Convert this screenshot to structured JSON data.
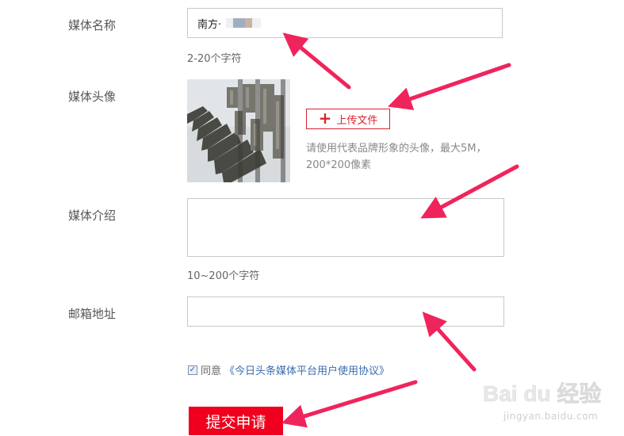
{
  "form": {
    "name_label": "媒体名称",
    "name_value": "南方·",
    "name_hint": "2-20个字符",
    "avatar_label": "媒体头像",
    "upload_label": "上传文件",
    "upload_hint_line1": "请使用代表品牌形象的头像，最大5M，",
    "upload_hint_line2": "200*200像素",
    "intro_label": "媒体介绍",
    "intro_hint": "10~200个字符",
    "email_label": "邮箱地址",
    "agree_prefix": "同意",
    "agree_link": "《今日头条媒体平台用户使用协议》",
    "agree_checked": true,
    "submit_label": "提交申请"
  },
  "watermark": {
    "logo_text": "Bai du 经验",
    "url": "jingyan.baidu.com"
  },
  "colors": {
    "accent_red": "#d9232e",
    "submit_bg": "#f0001e",
    "arrow": "#f0245c",
    "link": "#3a6bb0"
  }
}
